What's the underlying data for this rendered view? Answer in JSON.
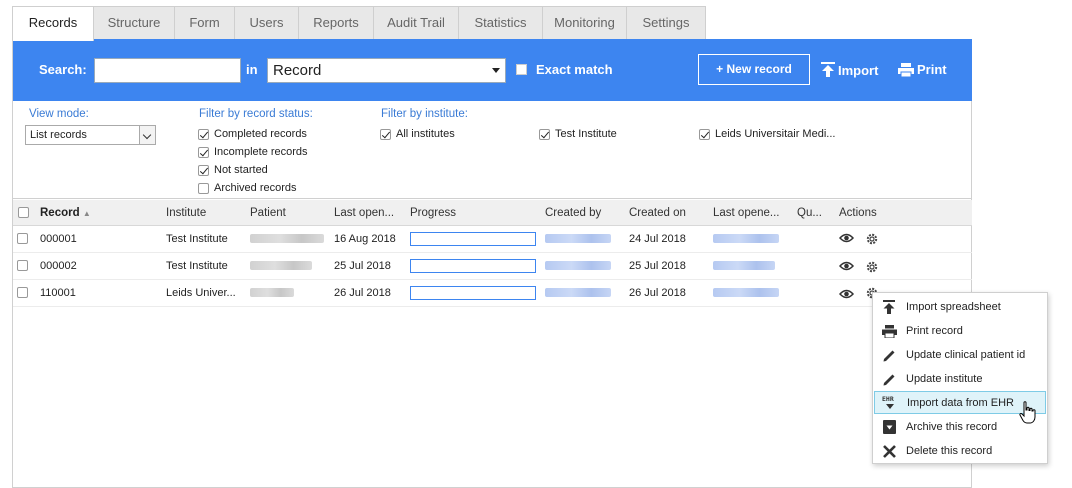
{
  "tabs": [
    "Records",
    "Structure",
    "Form",
    "Users",
    "Reports",
    "Audit Trail",
    "Statistics",
    "Monitoring",
    "Settings"
  ],
  "active_tab": "Records",
  "search": {
    "label": "Search:",
    "in_label": "in",
    "value": "",
    "scope": "Record",
    "exact_match": "Exact match",
    "new_record": "+ New record",
    "import": "Import",
    "print": "Print"
  },
  "filters": {
    "view_mode_title": "View mode:",
    "view_mode_value": "List records",
    "status_title": "Filter by record status:",
    "status": [
      {
        "label": "Completed records",
        "checked": true
      },
      {
        "label": "Incomplete records",
        "checked": true
      },
      {
        "label": "Not started",
        "checked": true
      },
      {
        "label": "Archived records",
        "checked": false
      }
    ],
    "institute_title": "Filter by institute:",
    "institutes": [
      {
        "label": "All institutes",
        "checked": true
      },
      {
        "label": "Test Institute",
        "checked": true
      },
      {
        "label": "Leids Universitair Medi...",
        "checked": true
      }
    ]
  },
  "table": {
    "columns": [
      "Record",
      "Institute",
      "Patient",
      "Last open...",
      "Progress",
      "Created by",
      "Created on",
      "Last opene...",
      "Qu...",
      "Actions"
    ],
    "rows": [
      {
        "record": "000001",
        "institute": "Test Institute",
        "last_opened": "16 Aug 2018",
        "created_on": "24 Jul 2018"
      },
      {
        "record": "000002",
        "institute": "Test Institute",
        "last_opened": "25 Jul 2018",
        "created_on": "25 Jul 2018"
      },
      {
        "record": "110001",
        "institute": "Leids Univer...",
        "last_opened": "26 Jul 2018",
        "created_on": "26 Jul 2018"
      }
    ]
  },
  "context_menu": {
    "items": [
      {
        "label": "Import spreadsheet",
        "icon": "upload-icon"
      },
      {
        "label": "Print record",
        "icon": "printer-icon"
      },
      {
        "label": "Update clinical patient id",
        "icon": "pencil-icon"
      },
      {
        "label": "Update institute",
        "icon": "pencil-icon"
      },
      {
        "label": "Import data from EHR",
        "icon": "ehr-icon"
      },
      {
        "label": "Archive this record",
        "icon": "archive-icon"
      },
      {
        "label": "Delete this record",
        "icon": "close-icon"
      }
    ],
    "hovered": "Import data from EHR"
  },
  "colors": {
    "accent": "#3d85f0",
    "link": "#3a7bd5",
    "menu_hover": "#dff3f9"
  }
}
